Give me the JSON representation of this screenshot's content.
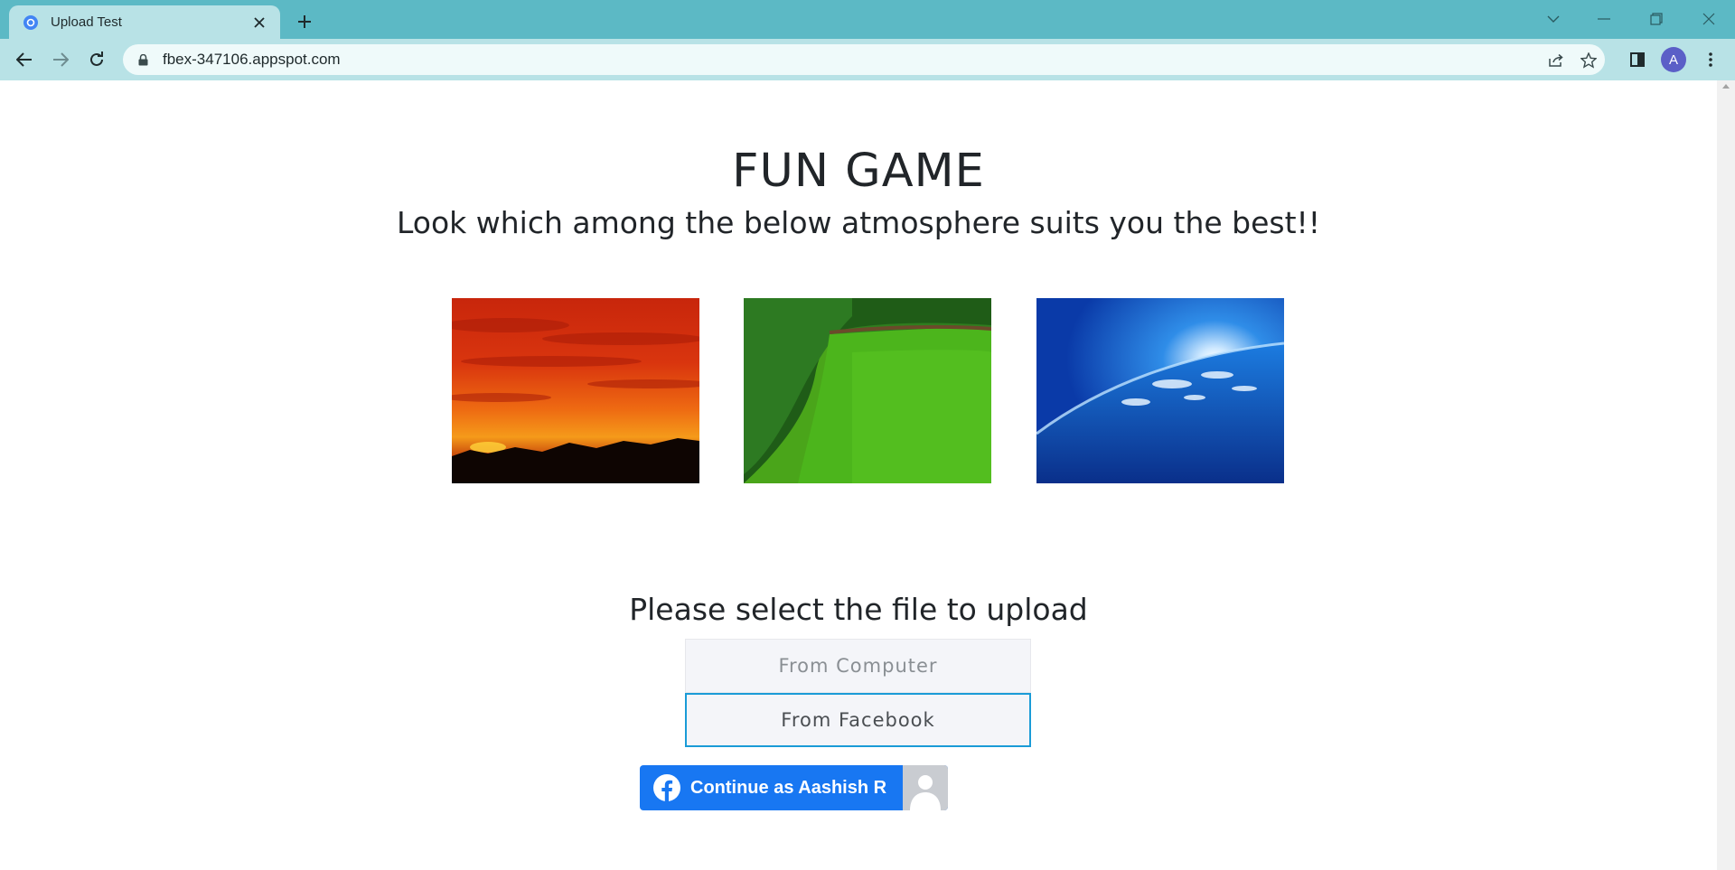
{
  "browser": {
    "tab_title": "Upload Test",
    "url": "fbex-347106.appspot.com",
    "profile_initial": "A",
    "accent": "#5cb9c5"
  },
  "page": {
    "title": "FUN GAME",
    "subtitle": "Look which among the below atmosphere suits you the best!!",
    "images": [
      {
        "subject": "red sunset sky over treeline"
      },
      {
        "subject": "green lawn garden"
      },
      {
        "subject": "earth atmosphere from space"
      }
    ],
    "upload_heading": "Please select the file to upload",
    "buttons": {
      "from_computer": "From Computer",
      "from_facebook": "From Facebook"
    },
    "facebook_login": {
      "label": "Continue as Aashish R",
      "brand_color": "#1877f2"
    }
  }
}
